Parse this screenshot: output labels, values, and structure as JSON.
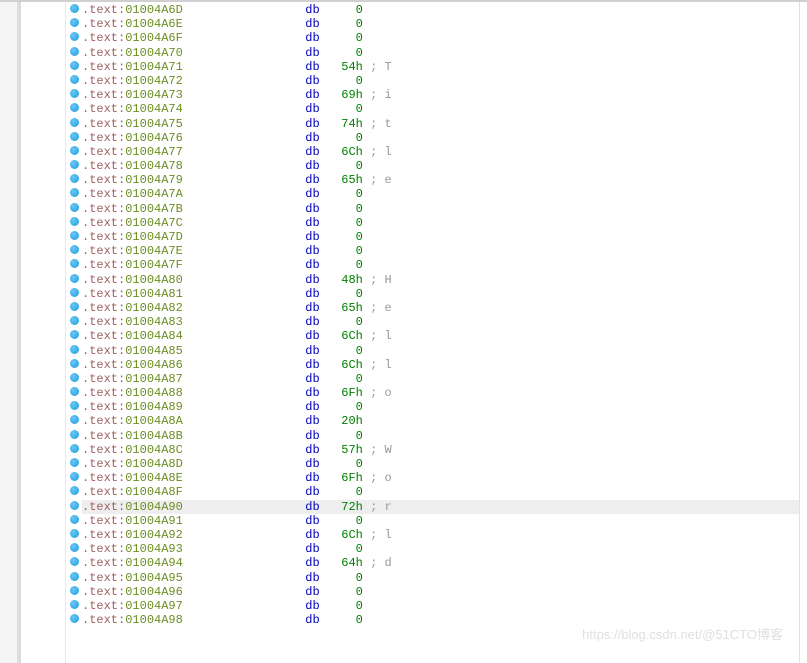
{
  "watermark": "https://blog.csdn.net/@51CTO博客",
  "segment_prefix": ".text:",
  "mnemonic": "db",
  "highlighted_address": "01004A90",
  "lines": [
    {
      "addr": "01004A6D",
      "val": "0",
      "cmt": ""
    },
    {
      "addr": "01004A6E",
      "val": "0",
      "cmt": ""
    },
    {
      "addr": "01004A6F",
      "val": "0",
      "cmt": ""
    },
    {
      "addr": "01004A70",
      "val": "0",
      "cmt": ""
    },
    {
      "addr": "01004A71",
      "val": "54h",
      "cmt": "; T"
    },
    {
      "addr": "01004A72",
      "val": "0",
      "cmt": ""
    },
    {
      "addr": "01004A73",
      "val": "69h",
      "cmt": "; i"
    },
    {
      "addr": "01004A74",
      "val": "0",
      "cmt": ""
    },
    {
      "addr": "01004A75",
      "val": "74h",
      "cmt": "; t"
    },
    {
      "addr": "01004A76",
      "val": "0",
      "cmt": ""
    },
    {
      "addr": "01004A77",
      "val": "6Ch",
      "cmt": "; l"
    },
    {
      "addr": "01004A78",
      "val": "0",
      "cmt": ""
    },
    {
      "addr": "01004A79",
      "val": "65h",
      "cmt": "; e"
    },
    {
      "addr": "01004A7A",
      "val": "0",
      "cmt": ""
    },
    {
      "addr": "01004A7B",
      "val": "0",
      "cmt": ""
    },
    {
      "addr": "01004A7C",
      "val": "0",
      "cmt": ""
    },
    {
      "addr": "01004A7D",
      "val": "0",
      "cmt": ""
    },
    {
      "addr": "01004A7E",
      "val": "0",
      "cmt": ""
    },
    {
      "addr": "01004A7F",
      "val": "0",
      "cmt": ""
    },
    {
      "addr": "01004A80",
      "val": "48h",
      "cmt": "; H"
    },
    {
      "addr": "01004A81",
      "val": "0",
      "cmt": ""
    },
    {
      "addr": "01004A82",
      "val": "65h",
      "cmt": "; e"
    },
    {
      "addr": "01004A83",
      "val": "0",
      "cmt": ""
    },
    {
      "addr": "01004A84",
      "val": "6Ch",
      "cmt": "; l"
    },
    {
      "addr": "01004A85",
      "val": "0",
      "cmt": ""
    },
    {
      "addr": "01004A86",
      "val": "6Ch",
      "cmt": "; l"
    },
    {
      "addr": "01004A87",
      "val": "0",
      "cmt": ""
    },
    {
      "addr": "01004A88",
      "val": "6Fh",
      "cmt": "; o"
    },
    {
      "addr": "01004A89",
      "val": "0",
      "cmt": ""
    },
    {
      "addr": "01004A8A",
      "val": "20h",
      "cmt": ""
    },
    {
      "addr": "01004A8B",
      "val": "0",
      "cmt": ""
    },
    {
      "addr": "01004A8C",
      "val": "57h",
      "cmt": "; W"
    },
    {
      "addr": "01004A8D",
      "val": "0",
      "cmt": ""
    },
    {
      "addr": "01004A8E",
      "val": "6Fh",
      "cmt": "; o"
    },
    {
      "addr": "01004A8F",
      "val": "0",
      "cmt": ""
    },
    {
      "addr": "01004A90",
      "val": "72h",
      "cmt": "; r"
    },
    {
      "addr": "01004A91",
      "val": "0",
      "cmt": ""
    },
    {
      "addr": "01004A92",
      "val": "6Ch",
      "cmt": "; l"
    },
    {
      "addr": "01004A93",
      "val": "0",
      "cmt": ""
    },
    {
      "addr": "01004A94",
      "val": "64h",
      "cmt": "; d"
    },
    {
      "addr": "01004A95",
      "val": "0",
      "cmt": ""
    },
    {
      "addr": "01004A96",
      "val": "0",
      "cmt": ""
    },
    {
      "addr": "01004A97",
      "val": "0",
      "cmt": ""
    },
    {
      "addr": "01004A98",
      "val": "0",
      "cmt": ""
    }
  ]
}
